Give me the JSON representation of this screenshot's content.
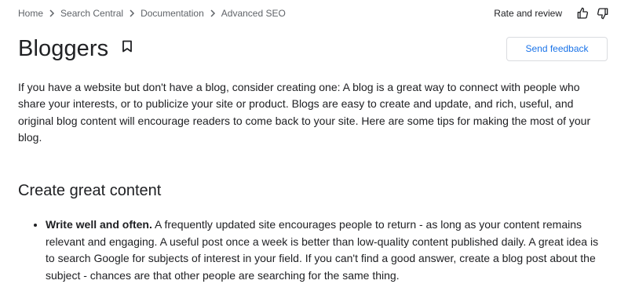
{
  "breadcrumb": {
    "items": [
      "Home",
      "Search Central",
      "Documentation",
      "Advanced SEO"
    ],
    "separator_icon": "chevron-right-icon"
  },
  "rating": {
    "label": "Rate and review",
    "thumb_up_icon": "thumb-up-icon",
    "thumb_down_icon": "thumb-down-icon"
  },
  "header": {
    "title": "Bloggers",
    "bookmark_icon": "bookmark-icon",
    "feedback_label": "Send feedback"
  },
  "content": {
    "intro": "If you have a website but don't have a blog, consider creating one: A blog is a great way to connect with people who share your interests, or to publicize your site or product. Blogs are easy to create and update, and rich, useful, and original blog content will encourage readers to come back to your site. Here are some tips for making the most of your blog.",
    "section_heading": "Create great content",
    "tips": [
      {
        "title": "Write well and often.",
        "body": " A frequently updated site encourages people to return - as long as your content remains relevant and engaging. A useful post once a week is better than low-quality content published daily. A great idea is to search Google for subjects of interest in your field. If you can't find a good answer, create a blog post about the subject - chances are that other people are searching for the same thing."
      }
    ]
  },
  "colors": {
    "text": "#202124",
    "muted": "#5f6368",
    "link": "#1a73e8",
    "border": "#dadce0"
  }
}
